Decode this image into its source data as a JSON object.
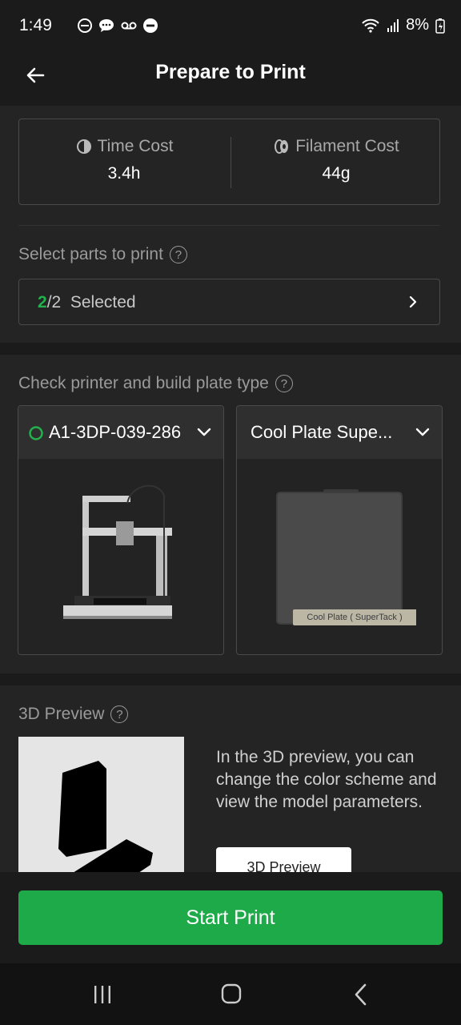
{
  "status": {
    "time": "1:49",
    "battery": "8%"
  },
  "header": {
    "title": "Prepare to Print"
  },
  "cost": {
    "time_label": "Time Cost",
    "time_value": "3.4h",
    "filament_label": "Filament Cost",
    "filament_value": "44g"
  },
  "parts": {
    "label": "Select parts to print",
    "selected_count": "2",
    "selected_total": "/2",
    "selected_text": "Selected"
  },
  "printer": {
    "label": "Check printer and build plate type",
    "printer_name": "A1-3DP-039-286",
    "plate_name": "Cool Plate Supe...",
    "plate_print": "Cool Plate ( SuperTack )"
  },
  "preview": {
    "label": "3D Preview",
    "description": "In the 3D preview, you can change the color scheme and view the model parameters.",
    "button": "3D Preview"
  },
  "actions": {
    "start_print": "Start Print"
  },
  "colors": {
    "accent": "#1faa49",
    "background": "#1b1b1b",
    "panel": "#242424"
  }
}
